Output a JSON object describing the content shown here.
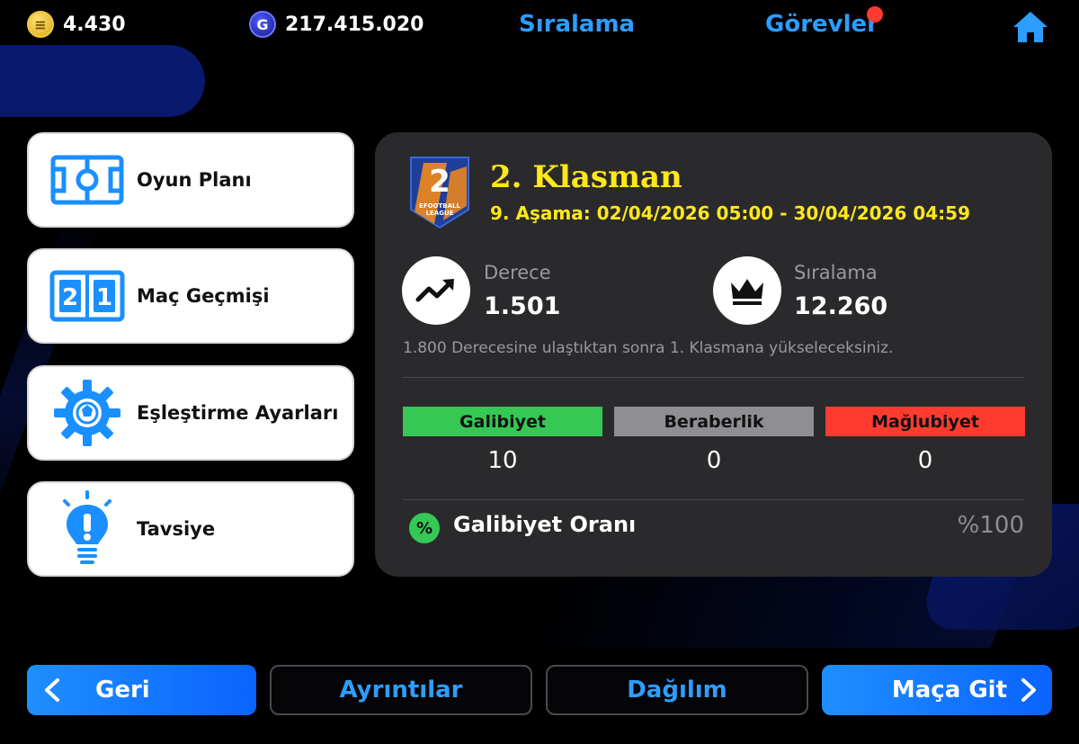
{
  "topbar": {
    "coins": "4.430",
    "gp": "217.415.020",
    "gp_symbol": "G",
    "ranking_label": "Sıralama",
    "missions_label": "Görevler",
    "home_icon": "home-icon"
  },
  "menu": [
    {
      "label": "Oyun Planı",
      "icon": "game-plan-icon"
    },
    {
      "label": "Maç Geçmişi",
      "icon": "scoreboard-icon"
    },
    {
      "label": "Eşleştirme Ayarları",
      "icon": "gear-icon"
    },
    {
      "label": "Tavsiye",
      "icon": "lightbulb-icon"
    }
  ],
  "division": {
    "badge_number": "2",
    "badge_text1": "EFOOTBALL",
    "badge_text2": "LEAGUE",
    "title": "2. Klasman",
    "stage": "9. Aşama: 02/04/2026 05:00 - 30/04/2026 04:59",
    "rating_label": "Derece",
    "rating_value": "1.501",
    "rank_label": "Sıralama",
    "rank_value": "12.260",
    "note": "1.800 Derecesine ulaştıktan sonra 1. Klasmana yükseleceksiniz."
  },
  "results": {
    "win_label": "Galibiyet",
    "win_value": "10",
    "draw_label": "Beraberlik",
    "draw_value": "0",
    "loss_label": "Mağlubiyet",
    "loss_value": "0",
    "win_rate_symbol": "%",
    "win_rate_label": "Galibiyet Oranı",
    "win_rate_value": "%100"
  },
  "colors": {
    "accent_blue": "#2d9dff",
    "division_yellow": "#ffe81a",
    "win_green": "#35c855",
    "draw_gray": "#8e8e93",
    "loss_red": "#ff3b30"
  },
  "buttons": {
    "back": "Geri",
    "details": "Ayrıntılar",
    "distribution": "Dağılım",
    "go_match": "Maça Git"
  }
}
